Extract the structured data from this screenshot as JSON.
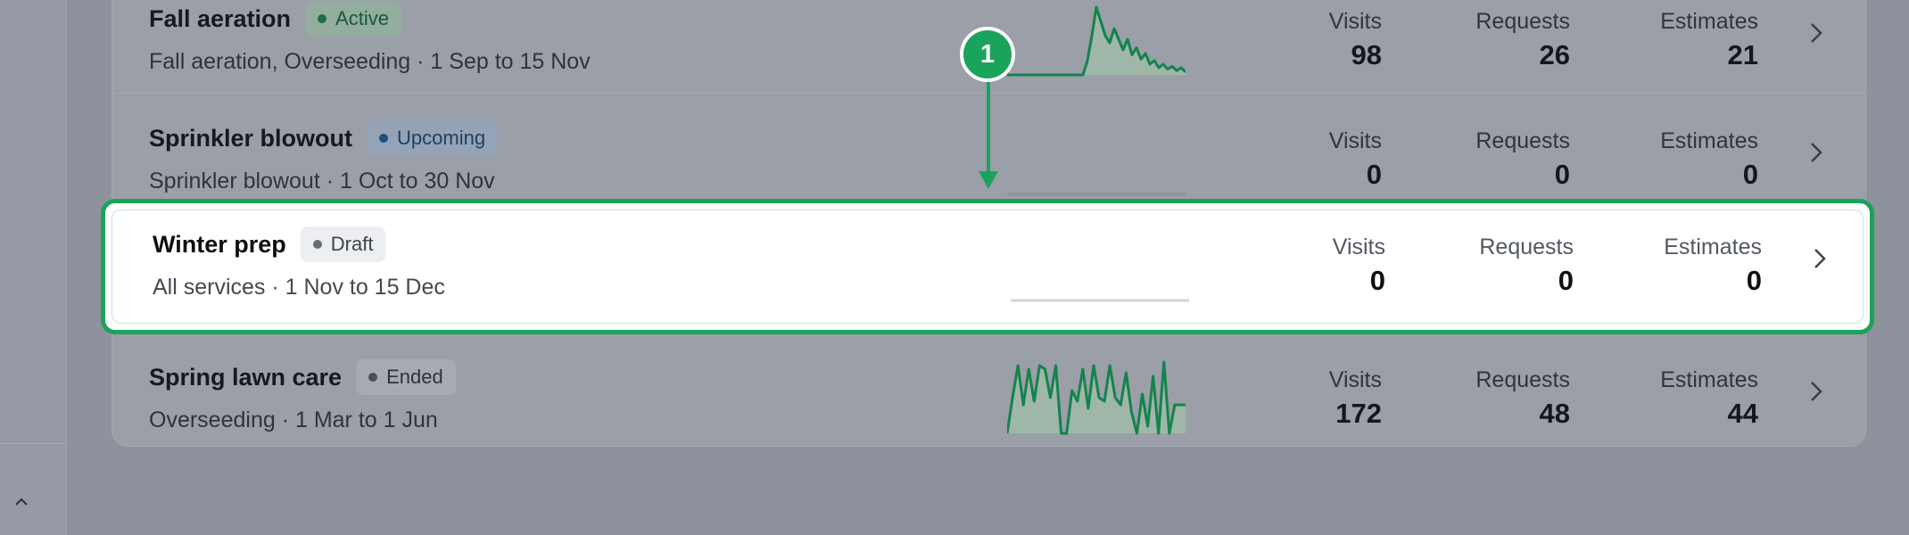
{
  "campaigns": [
    {
      "title": "Fall aeration",
      "status": "Active",
      "subtitle": "Fall aeration, Overseeding · 1 Sep to 15 Nov",
      "stats": {
        "visits": "98",
        "requests": "26",
        "estimates": "21"
      },
      "sparkline": [
        0,
        0,
        0,
        0,
        0,
        0,
        0,
        0,
        0,
        0,
        0,
        0,
        0,
        0,
        0,
        0,
        0,
        0,
        0.2,
        0.55,
        0.95,
        0.75,
        0.55,
        0.45,
        0.65,
        0.5,
        0.35,
        0.5,
        0.28,
        0.38,
        0.22,
        0.3,
        0.15,
        0.2,
        0.1,
        0.15,
        0.08,
        0.12,
        0.06,
        0.1,
        0.04
      ]
    },
    {
      "title": "Sprinkler blowout",
      "status": "Upcoming",
      "subtitle": "Sprinkler blowout · 1 Oct to 30 Nov",
      "stats": {
        "visits": "0",
        "requests": "0",
        "estimates": "0"
      },
      "sparkline": [
        0,
        0
      ]
    },
    {
      "title": "Winter prep",
      "status": "Draft",
      "subtitle": "All services · 1 Nov to 15 Dec",
      "stats": {
        "visits": "0",
        "requests": "0",
        "estimates": "0"
      },
      "sparkline": [
        0,
        0
      ]
    },
    {
      "title": "Spring lawn care",
      "status": "Ended",
      "subtitle": "Overseeding · 1 Mar to 1 Jun",
      "stats": {
        "visits": "172",
        "requests": "48",
        "estimates": "44"
      },
      "sparkline": [
        0,
        0.5,
        0.95,
        0.4,
        0.9,
        0.45,
        0.95,
        0.9,
        0.5,
        0.95,
        0,
        0,
        0.6,
        0.45,
        0.9,
        0.35,
        0.95,
        0.5,
        0.45,
        0.95,
        0.5,
        0.4,
        0.85,
        0.3,
        0,
        0.55,
        0.1,
        0.8,
        0,
        1,
        0,
        0.4,
        0.4,
        0.4
      ]
    }
  ],
  "stat_labels": {
    "visits": "Visits",
    "requests": "Requests",
    "estimates": "Estimates"
  },
  "callout": {
    "number": "1"
  },
  "colors": {
    "accent_green": "#1aa35a",
    "sparkline_line": "#14834c",
    "sparkline_fill": "#9fb7a8",
    "flat_line": "#8e929b"
  },
  "icons": {
    "row_action": "chevron-right-icon",
    "sidebar_toggle": "chevron-up-icon"
  }
}
